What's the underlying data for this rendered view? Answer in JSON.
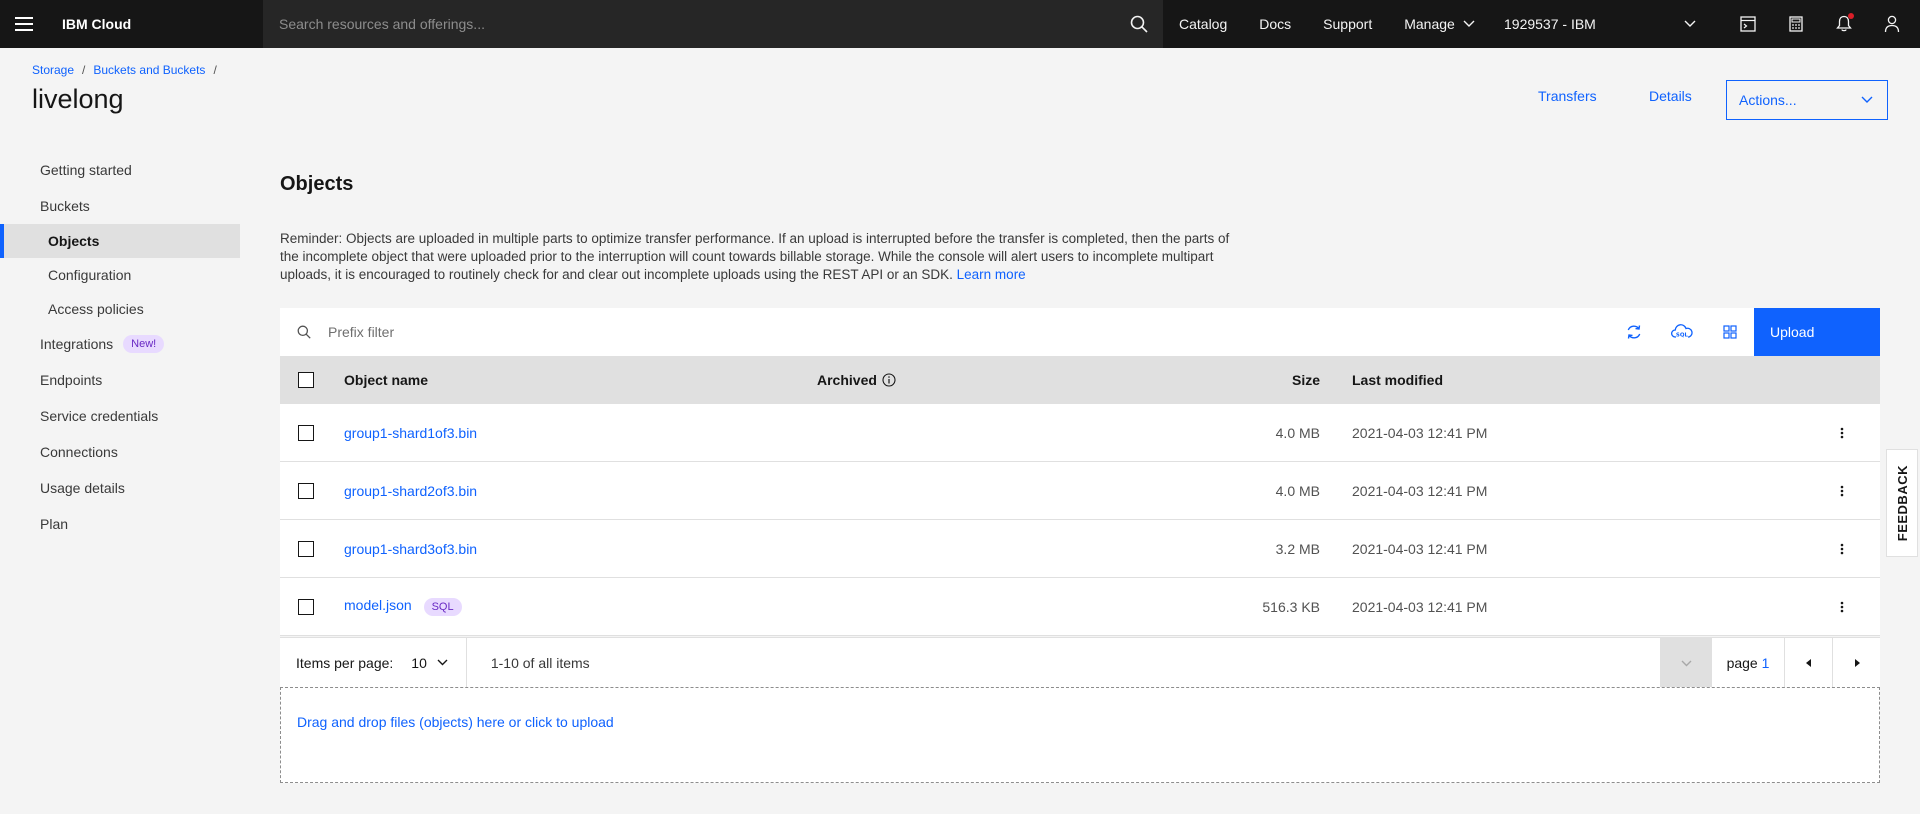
{
  "header": {
    "brand": "IBM Cloud",
    "search_placeholder": "Search resources and offerings...",
    "nav": [
      "Catalog",
      "Docs",
      "Support",
      "Manage"
    ],
    "account": "1929537 - IBM"
  },
  "breadcrumb": [
    "Storage",
    "Buckets and Buckets"
  ],
  "page_title": "livelong",
  "header_actions": {
    "transfers": "Transfers",
    "details": "Details",
    "actions": "Actions..."
  },
  "sidebar": {
    "items": [
      {
        "label": "Getting started"
      },
      {
        "label": "Buckets"
      },
      {
        "label": "Objects"
      },
      {
        "label": "Configuration"
      },
      {
        "label": "Access policies"
      },
      {
        "label": "Integrations",
        "badge": "New!"
      },
      {
        "label": "Endpoints"
      },
      {
        "label": "Service credentials"
      },
      {
        "label": "Connections"
      },
      {
        "label": "Usage details"
      },
      {
        "label": "Plan"
      }
    ]
  },
  "objects": {
    "title": "Objects",
    "reminder": "Reminder: Objects are uploaded in multiple parts to optimize transfer performance. If an upload is interrupted before the transfer is completed, then the parts of the incomplete object that were uploaded prior to the interruption will count towards billable storage. While the console will alert users to incomplete multipart uploads, it is encouraged to routinely check for and clear out incomplete uploads using the REST API or an SDK.",
    "learn_more": "Learn more",
    "filter_placeholder": "Prefix filter",
    "upload": "Upload",
    "columns": {
      "name": "Object name",
      "archived": "Archived",
      "size": "Size",
      "modified": "Last modified"
    },
    "rows": [
      {
        "name": "group1-shard1of3.bin",
        "size": "4.0 MB",
        "modified": "2021-04-03 12:41 PM"
      },
      {
        "name": "group1-shard2of3.bin",
        "size": "4.0 MB",
        "modified": "2021-04-03 12:41 PM"
      },
      {
        "name": "group1-shard3of3.bin",
        "size": "3.2 MB",
        "modified": "2021-04-03 12:41 PM"
      },
      {
        "name": "model.json",
        "tag": "SQL",
        "size": "516.3 KB",
        "modified": "2021-04-03 12:41 PM"
      }
    ],
    "pagination": {
      "items_per_page_label": "Items per page:",
      "items_per_page": "10",
      "range": "1-10 of all items",
      "page_label": "page",
      "page": "1"
    },
    "dropzone": "Drag and drop files (objects) here or click to upload"
  },
  "feedback": "FEEDBACK",
  "colors": {
    "accent": "#0f62fe",
    "header_bg": "#161616",
    "tag_bg": "#e8daff",
    "tag_fg": "#6929c4"
  }
}
